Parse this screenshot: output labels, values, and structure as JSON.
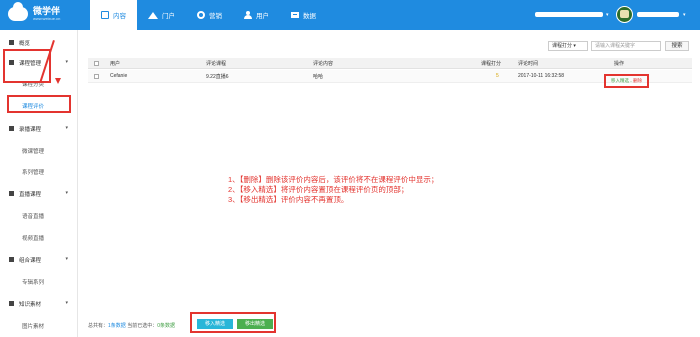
{
  "brand": {
    "title": "微学伴",
    "subtitle": "www.weixue.cn"
  },
  "nav": [
    {
      "label": "内容",
      "icon": "content-icon",
      "active": true
    },
    {
      "label": "门户",
      "icon": "home-icon"
    },
    {
      "label": "营销",
      "icon": "gear-icon"
    },
    {
      "label": "用户",
      "icon": "user-icon"
    },
    {
      "label": "数据",
      "icon": "data-icon"
    }
  ],
  "header": {
    "dropdown_caret": "▾",
    "user_caret": "▾"
  },
  "sidebar": {
    "overview": "概览",
    "course_mgmt": "课程管理",
    "course_category": "课程分类",
    "course_review": "课程评价",
    "recorded": "录播课程",
    "micro_mgmt": "微课管理",
    "series_mgmt": "系列管理",
    "live": "直播课程",
    "audio_live": "语音直播",
    "video_live": "视频直播",
    "bundle": "组合课程",
    "topic_series": "专辑系列",
    "materials": "知识素材",
    "image_materials": "图片素材",
    "arrow": "▾"
  },
  "filter": {
    "select_value": "课程打分 ▾",
    "search_placeholder": "请输入课程关键字",
    "search_button": "搜索"
  },
  "table": {
    "headers": [
      "用户",
      "评论课程",
      "评论内容",
      "课程打分",
      "评论时间",
      "操作"
    ],
    "rows": [
      {
        "user": "Cefanie",
        "course": "9.22直播6",
        "content": "哈哈",
        "rating": "5",
        "time": "2017-10-11 16:32:58",
        "op_feature": "移入精选",
        "op_sep": " - ",
        "op_delete": "删除"
      }
    ]
  },
  "notes": [
    "1、【删除】删除该评价内容后，该评价将不在课程评价中显示；",
    "2、【移入精选】将评价内容置顶在课程评价页的顶部；",
    "3、【移出精选】评价内容不再置顶。"
  ],
  "footer": {
    "total_prefix": "总共有：",
    "total_value": "1条数据",
    "selected_prefix": "当前已选中：",
    "selected_value": "0条数据",
    "btn_feature": "移入精选",
    "btn_unfeature": "移出精选"
  },
  "colors": {
    "topbar": "#1f8be0",
    "annotation": "#e3342f"
  }
}
